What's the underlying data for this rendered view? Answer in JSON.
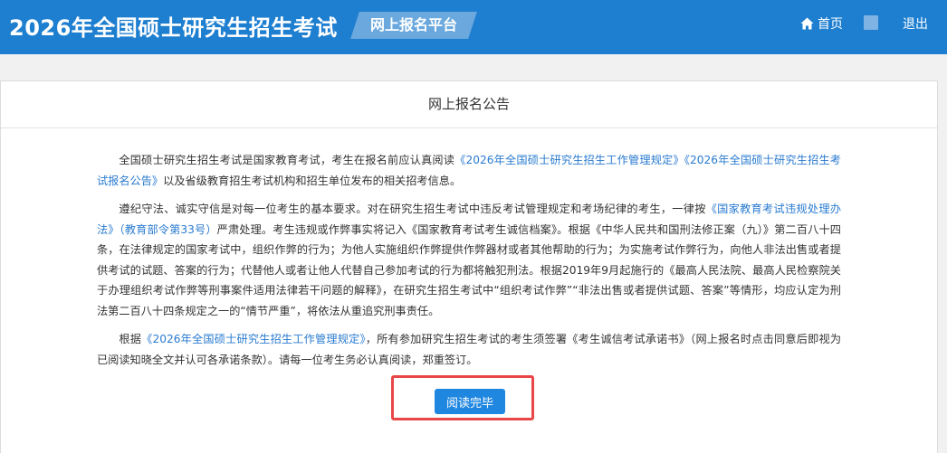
{
  "header": {
    "title": "2026年全国硕士研究生招生考试",
    "platform_label": "网上报名平台",
    "home_label": "首页",
    "logout_label": "退出"
  },
  "notice": {
    "title": "网上报名公告",
    "p1": {
      "t1": "全国硕士研究生招生考试是国家教育考试，考生在报名前应认真阅读",
      "l1": "《2026年全国硕士研究生招生工作管理规定》《2026年全国硕士研究生招生考试报名公告》",
      "t2": "以及省级教育招生考试机构和招生单位发布的相关招考信息。"
    },
    "p2": {
      "t1": "遵纪守法、诚实守信是对每一位考生的基本要求。对在研究生招生考试中违反考试管理规定和考场纪律的考生，一律按",
      "l1": "《国家教育考试违规处理办法》（教育部令第33号）",
      "t2": "严肃处理。考生违规或作弊事实将记入《国家教育考试考生诚信档案》。根据《中华人民共和国刑法修正案（九）》第二百八十四条，在法律规定的国家考试中，组织作弊的行为；为他人实施组织作弊提供作弊器材或者其他帮助的行为；为实施考试作弊行为，向他人非法出售或者提供考试的试题、答案的行为；代替他人或者让他人代替自己参加考试的行为都将触犯刑法。根据2019年9月起施行的《最高人民法院、最高人民检察院关于办理组织考试作弊等刑事案件适用法律若干问题的解释》，在研究生招生考试中“组织考试作弊”“非法出售或者提供试题、答案”等情形，均应认定为刑法第二百八十四条规定之一的“情节严重”，将依法从重追究刑事责任。"
    },
    "p3": {
      "t1": "根据",
      "l1": "《2026年全国硕士研究生招生工作管理规定》",
      "t2": "，所有参加研究生招生考试的考生须签署《考生诚信考试承诺书》（网上报名时点击同意后即视为已阅读知晓全文并认可各承诺条款）。请每一位考生务必认真阅读，郑重签订。"
    },
    "button_label": "阅读完毕"
  },
  "colors": {
    "header_bg": "#1e7fd0",
    "link": "#2a7bd0",
    "button": "#2087e0",
    "highlight_frame": "#e94747"
  },
  "icons": {
    "home": "home-icon"
  }
}
